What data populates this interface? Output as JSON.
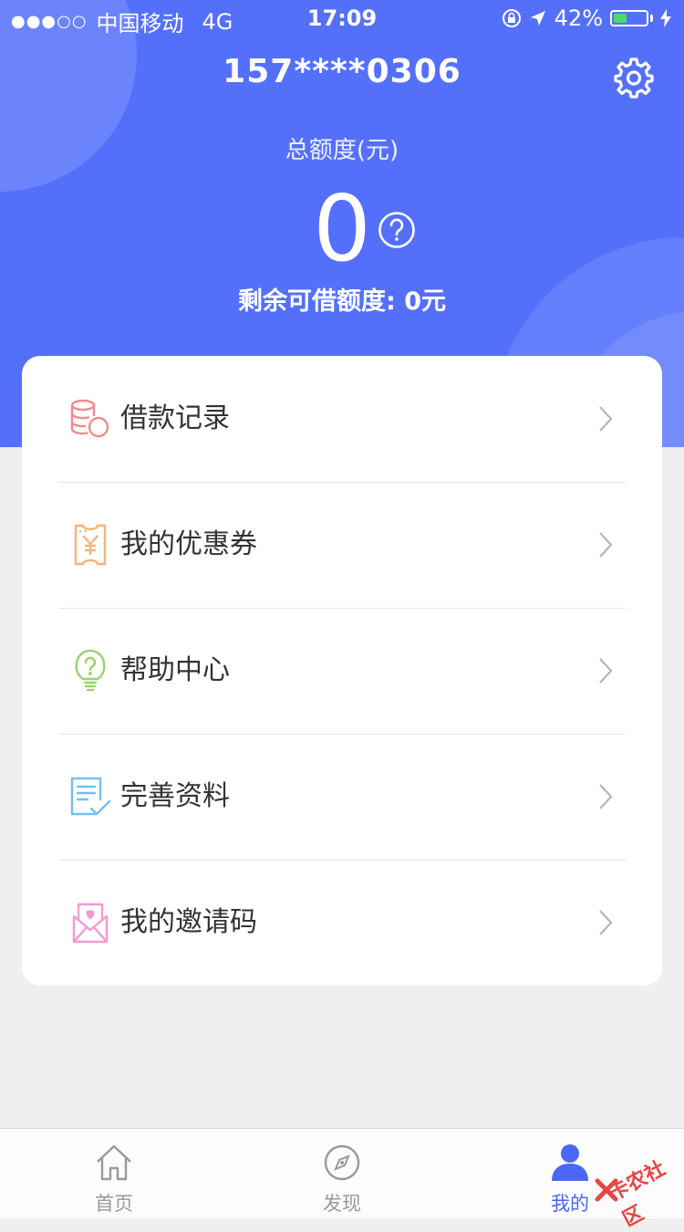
{
  "status": {
    "dots": "●●●○○",
    "carrier": "中国移动",
    "network": "4G",
    "time": "17:09",
    "battery": "42%",
    "battery_level": 0.42
  },
  "header": {
    "phone": "157****0306",
    "total_label": "总额度(元)",
    "total_amount": "0",
    "remaining": "剩余可借额度: 0元"
  },
  "menu": {
    "items": [
      {
        "label": "借款记录",
        "icon": "coins-icon",
        "color": "#f28b8b"
      },
      {
        "label": "我的优惠券",
        "icon": "coupon-icon",
        "color": "#f5b47a"
      },
      {
        "label": "帮助中心",
        "icon": "lightbulb-icon",
        "color": "#9ad36a"
      },
      {
        "label": "完善资料",
        "icon": "document-check-icon",
        "color": "#6ec2ef"
      },
      {
        "label": "我的邀请码",
        "icon": "envelope-heart-icon",
        "color": "#f29ad6"
      }
    ]
  },
  "tabs": [
    {
      "label": "首页",
      "icon": "home-icon"
    },
    {
      "label": "发现",
      "icon": "compass-icon"
    },
    {
      "label": "我的",
      "icon": "user-icon"
    }
  ],
  "watermark": "卡农社区",
  "colors": {
    "header_bg": "#5470fb",
    "accent": "#4a67f5",
    "page_bg": "#efefef"
  }
}
